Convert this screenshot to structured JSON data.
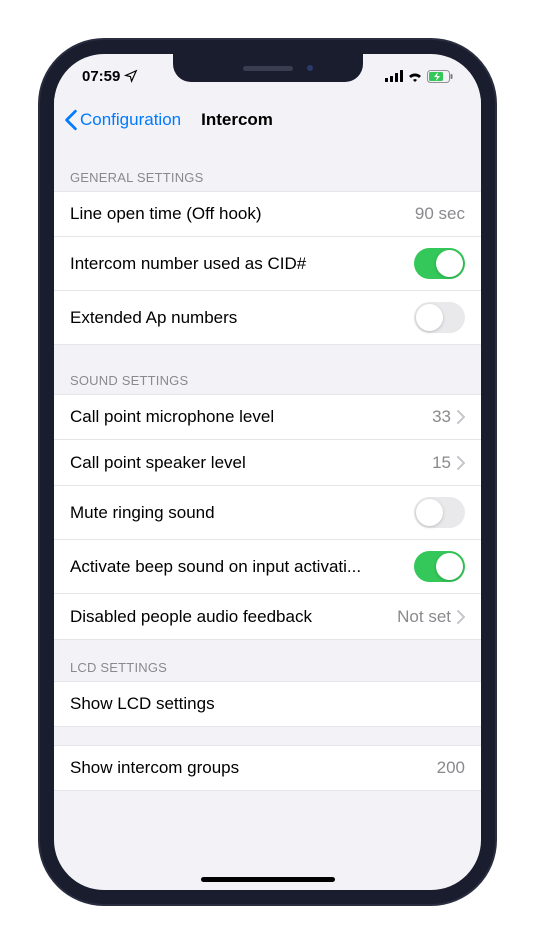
{
  "status": {
    "time": "07:59"
  },
  "nav": {
    "back": "Configuration",
    "title": "Intercom"
  },
  "sections": {
    "general": {
      "header": "GENERAL SETTINGS",
      "line_open": {
        "label": "Line open time (Off hook)",
        "value": "90 sec"
      },
      "cid": {
        "label": "Intercom number used as CID#",
        "on": true
      },
      "ext_ap": {
        "label": "Extended Ap numbers",
        "on": false
      }
    },
    "sound": {
      "header": "SOUND SETTINGS",
      "mic": {
        "label": "Call point microphone level",
        "value": "33"
      },
      "speaker": {
        "label": "Call point speaker level",
        "value": "15"
      },
      "mute": {
        "label": "Mute ringing sound",
        "on": false
      },
      "beep": {
        "label": "Activate beep sound on input activati...",
        "on": true
      },
      "audio_fb": {
        "label": "Disabled people audio feedback",
        "value": "Not set"
      }
    },
    "lcd": {
      "header": "LCD SETTINGS",
      "show_lcd": {
        "label": "Show LCD settings"
      }
    },
    "groups": {
      "show_groups": {
        "label": "Show intercom groups",
        "value": "200"
      }
    }
  }
}
